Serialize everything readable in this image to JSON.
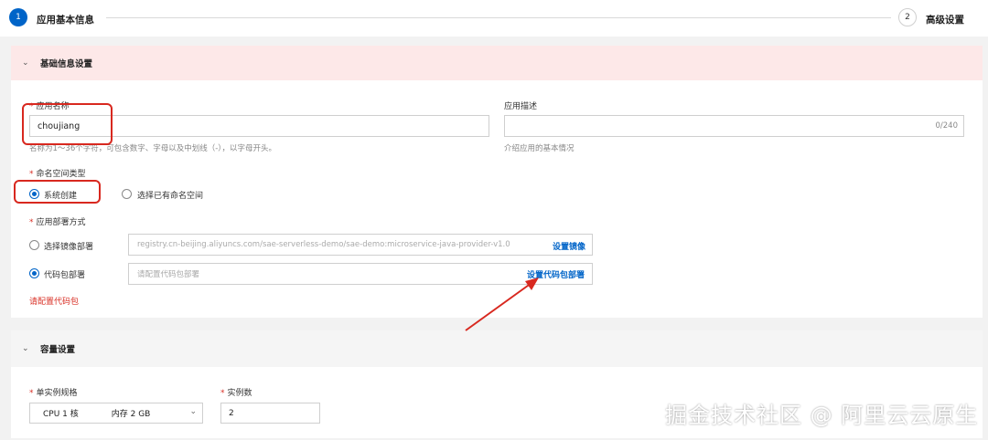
{
  "steps": [
    {
      "number": "1",
      "label": "应用基本信息"
    },
    {
      "number": "2",
      "label": "高级设置"
    }
  ],
  "basic": {
    "title": "基础信息设置",
    "app_name": {
      "label": "应用名称",
      "value": "choujiang",
      "hint": "名称为1～36个字符，可包含数字、字母以及中划线（-），以字母开头。"
    },
    "app_desc": {
      "label": "应用描述",
      "count": "0/240",
      "hint": "介绍应用的基本情况"
    },
    "namespace": {
      "label": "命名空间类型",
      "options": [
        "系统创建",
        "选择已有命名空间"
      ],
      "selected": 0
    },
    "deploy": {
      "label": "应用部署方式",
      "image_option": "选择镜像部署",
      "image_placeholder": "registry.cn-beijing.aliyuncs.com/sae-serverless-demo/sae-demo:microservice-java-provider-v1.0",
      "image_link": "设置镜像",
      "code_option": "代码包部署",
      "code_placeholder": "请配置代码包部署",
      "code_link": "设置代码包部署",
      "selected": "code",
      "error": "请配置代码包"
    }
  },
  "capacity": {
    "title": "容量设置",
    "spec": {
      "label": "单实例规格",
      "cpu": "CPU 1 核",
      "memory": "内存 2 GB"
    },
    "instances": {
      "label": "实例数",
      "value": "2"
    }
  },
  "watermark": "掘金技术社区 @ 阿里云云原生",
  "colors": {
    "accent": "#0064c8",
    "error": "#d93026",
    "annotation": "#d8281f"
  }
}
